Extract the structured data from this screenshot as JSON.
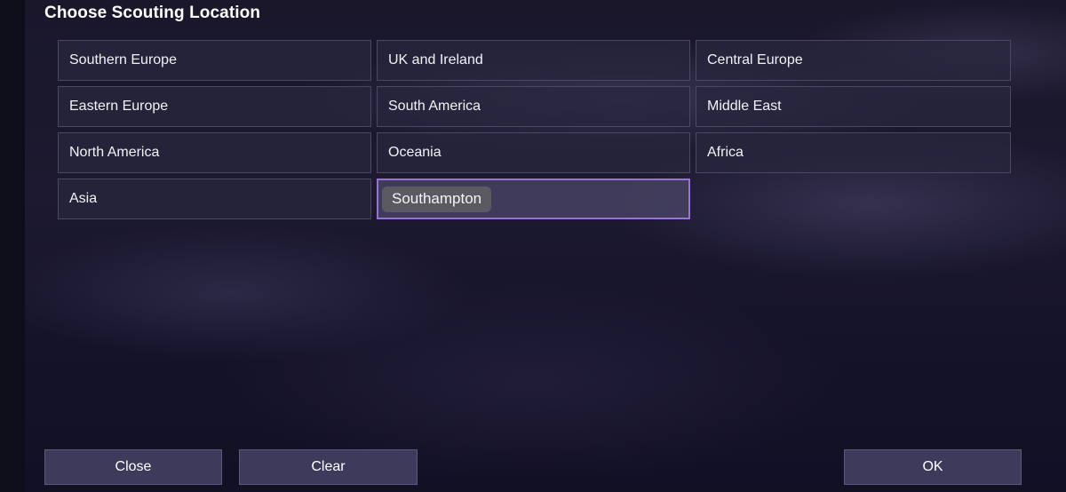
{
  "dialog": {
    "title": "Choose Scouting Location"
  },
  "locations": [
    {
      "label": "Southern Europe",
      "name": "location-southern-europe"
    },
    {
      "label": "UK and Ireland",
      "name": "location-uk-and-ireland"
    },
    {
      "label": "Central Europe",
      "name": "location-central-europe"
    },
    {
      "label": "Eastern Europe",
      "name": "location-eastern-europe"
    },
    {
      "label": "South America",
      "name": "location-south-america"
    },
    {
      "label": "Middle East",
      "name": "location-middle-east"
    },
    {
      "label": "North America",
      "name": "location-north-america"
    },
    {
      "label": "Oceania",
      "name": "location-oceania"
    },
    {
      "label": "Africa",
      "name": "location-africa"
    },
    {
      "label": "Asia",
      "name": "location-asia"
    }
  ],
  "search": {
    "value": "Southampton"
  },
  "footer": {
    "close_label": "Close",
    "clear_label": "Clear",
    "ok_label": "OK"
  },
  "colors": {
    "accent_border": "#9a72d6",
    "button_bg": "#3d3a5c",
    "cell_bg": "#28263e"
  }
}
